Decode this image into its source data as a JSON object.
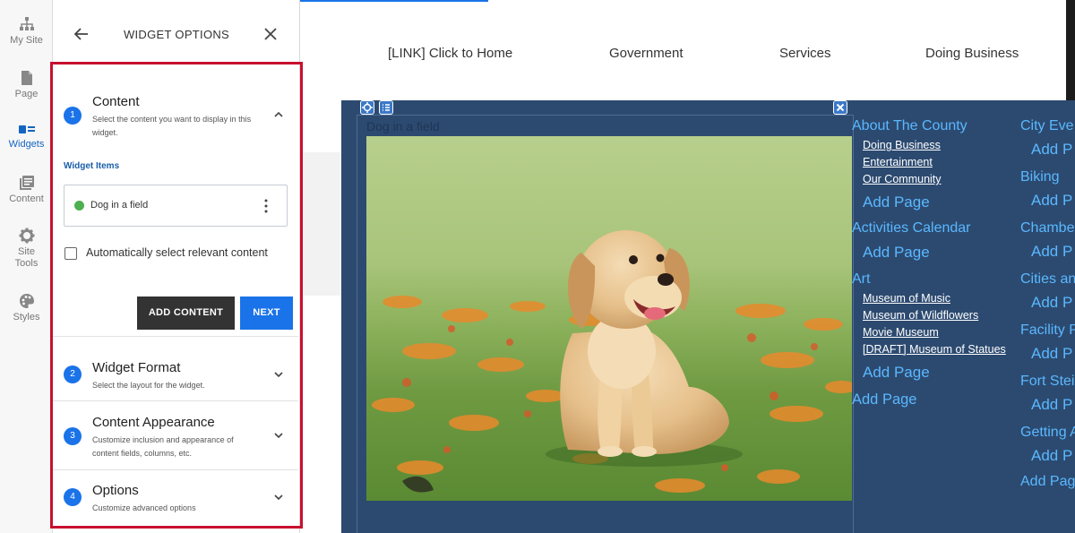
{
  "rail": {
    "items": [
      {
        "label": "My Site",
        "icon": "sitemap-icon"
      },
      {
        "label": "Page",
        "icon": "page-icon"
      },
      {
        "label": "Widgets",
        "icon": "widgets-icon"
      },
      {
        "label": "Content",
        "icon": "content-icon"
      },
      {
        "label_line1": "Site",
        "label_line2": "Tools",
        "icon": "gear-icon"
      },
      {
        "label": "Styles",
        "icon": "palette-icon"
      }
    ],
    "active_index": 2
  },
  "panel": {
    "title": "WIDGET OPTIONS",
    "steps": [
      {
        "number": "1",
        "title": "Content",
        "desc_line1": "Select the content you want to display in this",
        "desc_line2": "widget."
      },
      {
        "number": "2",
        "title": "Widget Format",
        "desc_line1": "Select the layout for the widget."
      },
      {
        "number": "3",
        "title": "Content Appearance",
        "desc_line1": "Customize inclusion and appearance of",
        "desc_line2": "content fields, columns, etc."
      },
      {
        "number": "4",
        "title": "Options",
        "desc_line1": "Customize advanced options"
      }
    ],
    "widget_items_label": "Widget Items",
    "widget_item": {
      "label": "Dog in a field",
      "status_color": "#4caf50"
    },
    "auto_select_label": "Automatically select relevant content",
    "auto_select_checked": false,
    "add_content_label": "ADD CONTENT",
    "next_label": "NEXT"
  },
  "site_nav": {
    "links": [
      "[LINK] Click to Home",
      "Government",
      "Services",
      "Doing Business"
    ]
  },
  "widget": {
    "item_title": "Dog in a field",
    "col1": {
      "groups": [
        {
          "title": "About The County",
          "subs": [
            "Doing Business",
            "Entertainment",
            "Our Community"
          ],
          "add": "Add Page"
        },
        {
          "title": "Activities Calendar",
          "subs": [],
          "add": "Add Page"
        },
        {
          "title": "Art",
          "subs": [
            "Museum of Music",
            "Museum of Wildflowers",
            "Movie Museum",
            "[DRAFT] Museum of Statues"
          ],
          "add": "Add Page"
        }
      ],
      "bottom_add": "Add Page"
    },
    "col2": {
      "groups": [
        {
          "title": "City Eve",
          "add": "Add P"
        },
        {
          "title": "Biking",
          "add": "Add P"
        },
        {
          "title": "Chambe",
          "add": "Add P"
        },
        {
          "title": "Cities an",
          "add": "Add P"
        },
        {
          "title": "Facility P",
          "add": "Add P"
        },
        {
          "title": "Fort Stei",
          "add": "Add P"
        },
        {
          "title": "Getting A",
          "add": "Add P"
        }
      ],
      "bottom_add": "Add Pag"
    }
  },
  "colors": {
    "accent_blue": "#1a73e8",
    "highlight_red": "#c8102e",
    "widget_bg": "#2c4a70",
    "link_blue": "#5ab8ff"
  }
}
